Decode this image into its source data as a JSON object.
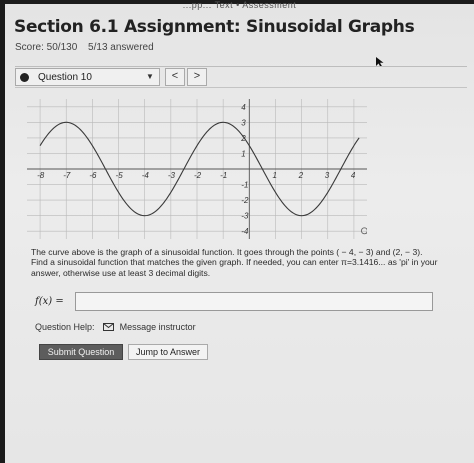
{
  "header": {
    "top_strip": "...pp... Text • Assessment",
    "title": "Section 6.1 Assignment: Sinusoidal Graphs",
    "score": "Score: 50/130",
    "answered": "5/13 answered"
  },
  "question_nav": {
    "selected": "Question 10",
    "prev_label": "<",
    "next_label": ">"
  },
  "graph": {
    "x_tick_labels": [
      "-8",
      "-7",
      "-6",
      "-5",
      "-4",
      "-3",
      "-2",
      "-1",
      "1",
      "2",
      "3",
      "4"
    ],
    "y_tick_labels": [
      "4",
      "3",
      "2",
      "1",
      "-1",
      "-2",
      "-3",
      "-4"
    ],
    "zoom_icon": "magnifier-icon"
  },
  "question": {
    "line1": "The curve above is the graph of a sinusoidal function. It goes through the points ( − 4, − 3) and (2, − 3).",
    "line2": "Find a sinusoidal function that matches the given graph. If needed, you can enter π=3.1416... as 'pi' in your",
    "line3": "answer, otherwise use at least 3 decimal digits."
  },
  "answer": {
    "label": "f(x) =",
    "value": ""
  },
  "help": {
    "label": "Question Help:",
    "message_link": "Message instructor",
    "icon": "mail-icon"
  },
  "buttons": {
    "submit": "Submit Question",
    "jump": "Jump to Answer"
  },
  "colors": {
    "submit_bg": "#5d5d5d",
    "page_bg": "#e8e8e8",
    "dark_surround": "#1c1c1c"
  }
}
